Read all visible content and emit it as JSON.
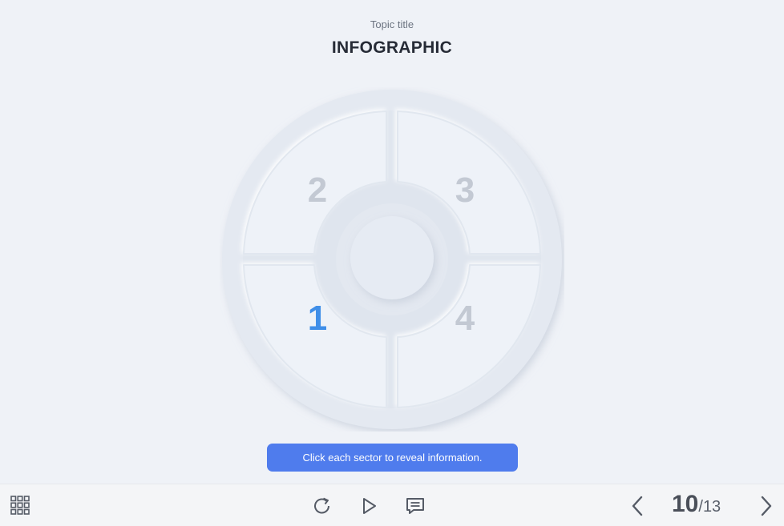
{
  "header": {
    "subtitle": "Topic title",
    "title": "INFOGRAPHIC"
  },
  "wheel": {
    "sectors": [
      {
        "label": "1",
        "active": true
      },
      {
        "label": "2",
        "active": false
      },
      {
        "label": "3",
        "active": false
      },
      {
        "label": "4",
        "active": false
      }
    ],
    "active_color": "#3f8ee8",
    "inactive_color": "#c3c9d3"
  },
  "hint": {
    "text": "Click each sector to reveal information."
  },
  "toolbar": {
    "menu_icon": "grid-icon",
    "replay_icon": "replay-icon",
    "play_icon": "play-icon",
    "notes_icon": "comment-icon",
    "prev_icon": "chevron-left-icon",
    "next_icon": "chevron-right-icon",
    "current_page": "10",
    "separator": "/",
    "total_pages": "13"
  },
  "colors": {
    "background": "#eff2f7",
    "accent": "#4f7ced"
  }
}
